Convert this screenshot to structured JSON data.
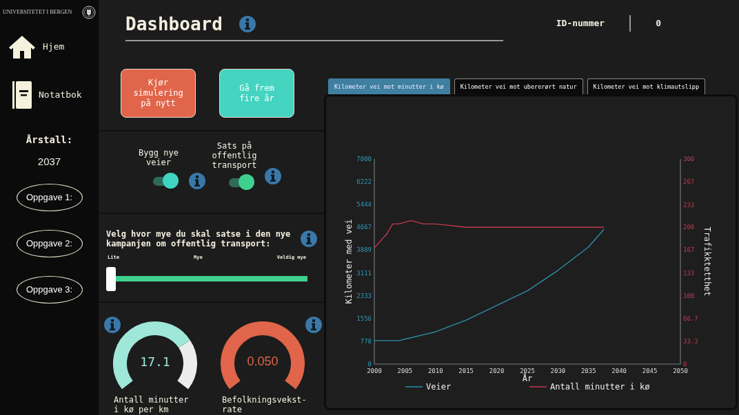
{
  "sidebar": {
    "logo_text": "UNIVERSITETET I BERGEN",
    "items": [
      {
        "label": "Hjem",
        "kind": "home"
      },
      {
        "label": "Notatbok",
        "kind": "notebook"
      }
    ],
    "year_label": "Årstall:",
    "year": "2037",
    "tasks": [
      "Oppgave 1:",
      "Oppgave 2:",
      "Oppgave 3:"
    ]
  },
  "header": {
    "title": "Dashboard",
    "id_label": "ID-nummer",
    "id_value": "0"
  },
  "buttons": [
    {
      "label": "Kjør simulering på nytt",
      "color": "#e0654a"
    },
    {
      "label": "Gå frem fire år",
      "color": "#45d4c0"
    }
  ],
  "toggles": [
    {
      "label": "Bygg nye veier",
      "on": true,
      "color": "#40d3c2"
    },
    {
      "label": "Sats på offentlig transport",
      "on": true,
      "color": "#3fd08f"
    }
  ],
  "campaign": {
    "question": "Velg hvor mye du skal satse i den nye kampanjen om offentlig transport:",
    "scale_labels": [
      "Lite",
      "Mye",
      "Veldig mye"
    ],
    "level": 0
  },
  "gauges": [
    {
      "value": "17.1",
      "label": "Antall minutter i kø per km",
      "color": "#9fe7d9"
    },
    {
      "value": "0.050",
      "label": "Befolkningsvekst-rate",
      "color": "#e0654a"
    }
  ],
  "tabs": [
    {
      "label": "Kilometer vei mot minutter i kø",
      "selected": true
    },
    {
      "label": "Kilometer vei mot ubererørt natur",
      "selected": false
    },
    {
      "label": "Kilometer vei mot klimautslipp",
      "selected": false
    }
  ],
  "chart": {
    "chart_data": {
      "type": "line",
      "xlabel": "År",
      "ylabel": "Kilometer med vei",
      "y2label": "Trafikktetthet",
      "x": [
        2000,
        2002,
        2003,
        2004,
        2006,
        2008,
        2010,
        2015,
        2020,
        2025,
        2030,
        2035,
        2037.5
      ],
      "series": [
        {
          "name": "Veier",
          "color": "#2e8fa8",
          "values": [
            800,
            800,
            800,
            800,
            900,
            1000,
            1100,
            1500,
            2000,
            2500,
            3200,
            4000,
            4600
          ]
        },
        {
          "name": "Antall minutter i kø",
          "color": "#c0394f",
          "axis": "y2",
          "values": [
            170,
            190,
            205,
            205,
            210,
            205,
            205,
            200,
            200,
            200,
            200,
            200,
            200
          ]
        }
      ],
      "legend": "bottom",
      "xlim": [
        2000,
        2050
      ],
      "ylim": [
        0,
        7000
      ],
      "y2lim": [
        0,
        300
      ],
      "xticks": [
        2000,
        2005,
        2010,
        2015,
        2020,
        2025,
        2030,
        2035,
        2040,
        2045,
        2050
      ],
      "yticks": [
        0,
        778,
        1556,
        2333,
        3111,
        3889,
        4667,
        5444,
        6222,
        7000
      ],
      "y2ticks": [
        0,
        33.3,
        66.7,
        100,
        133,
        167,
        200,
        233,
        267,
        300
      ]
    }
  }
}
